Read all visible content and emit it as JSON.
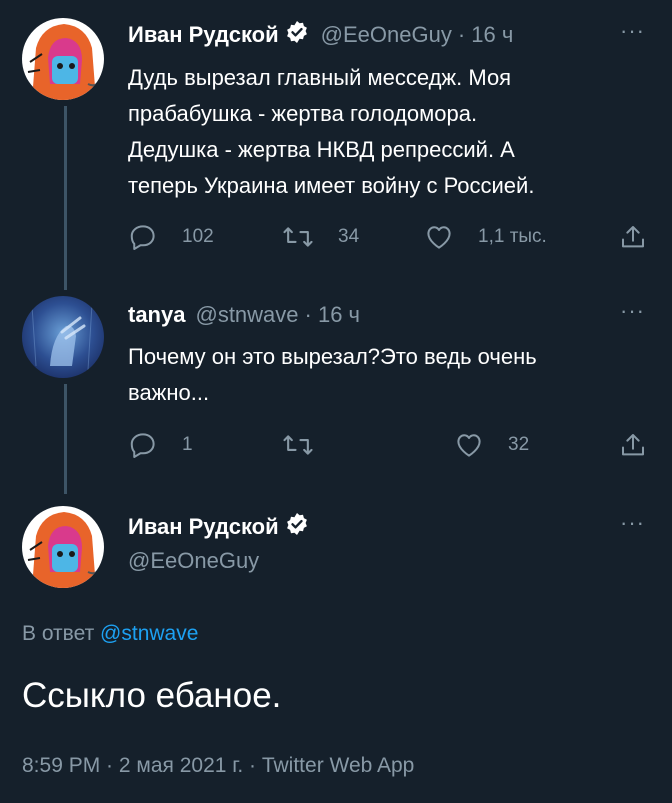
{
  "tweet1": {
    "name": "Иван Рудской",
    "handle": "@EeOneGuy",
    "time": "· 16 ч",
    "more": "···",
    "lines": [
      "Дудь вырезал главный месседж. Моя",
      "прабабушка - жертва голодомора.",
      "Дедушка - жертва НКВД репрессий. А",
      "теперь Украина имеет войну с Россией."
    ],
    "replies": "102",
    "retweets": "34",
    "likes": "1,1 тыс."
  },
  "tweet2": {
    "name": "tanya",
    "handle": "@stnwave",
    "time": "· 16 ч",
    "more": "···",
    "lines": [
      "Почему он это вырезал?Это ведь очень",
      "важно..."
    ],
    "replies": "1",
    "retweets": "",
    "likes": "32"
  },
  "tweet3": {
    "name": "Иван Рудской",
    "handle": "@EeOneGuy",
    "more": "···",
    "reply_prefix": "В ответ",
    "reply_to": "@stnwave",
    "text": "Ссыкло ебаное.",
    "meta": "8:59 PM · 2 мая 2021 г. · Twitter Web App"
  },
  "colors": {
    "background": "#15202b",
    "secondary_text": "#8899a6",
    "link": "#1da1f2",
    "thread_line": "#3d5466",
    "verified_badge": "#ffffff"
  },
  "icons": [
    "reply-icon",
    "retweet-icon",
    "like-icon",
    "share-icon",
    "verified-icon",
    "more-icon"
  ]
}
